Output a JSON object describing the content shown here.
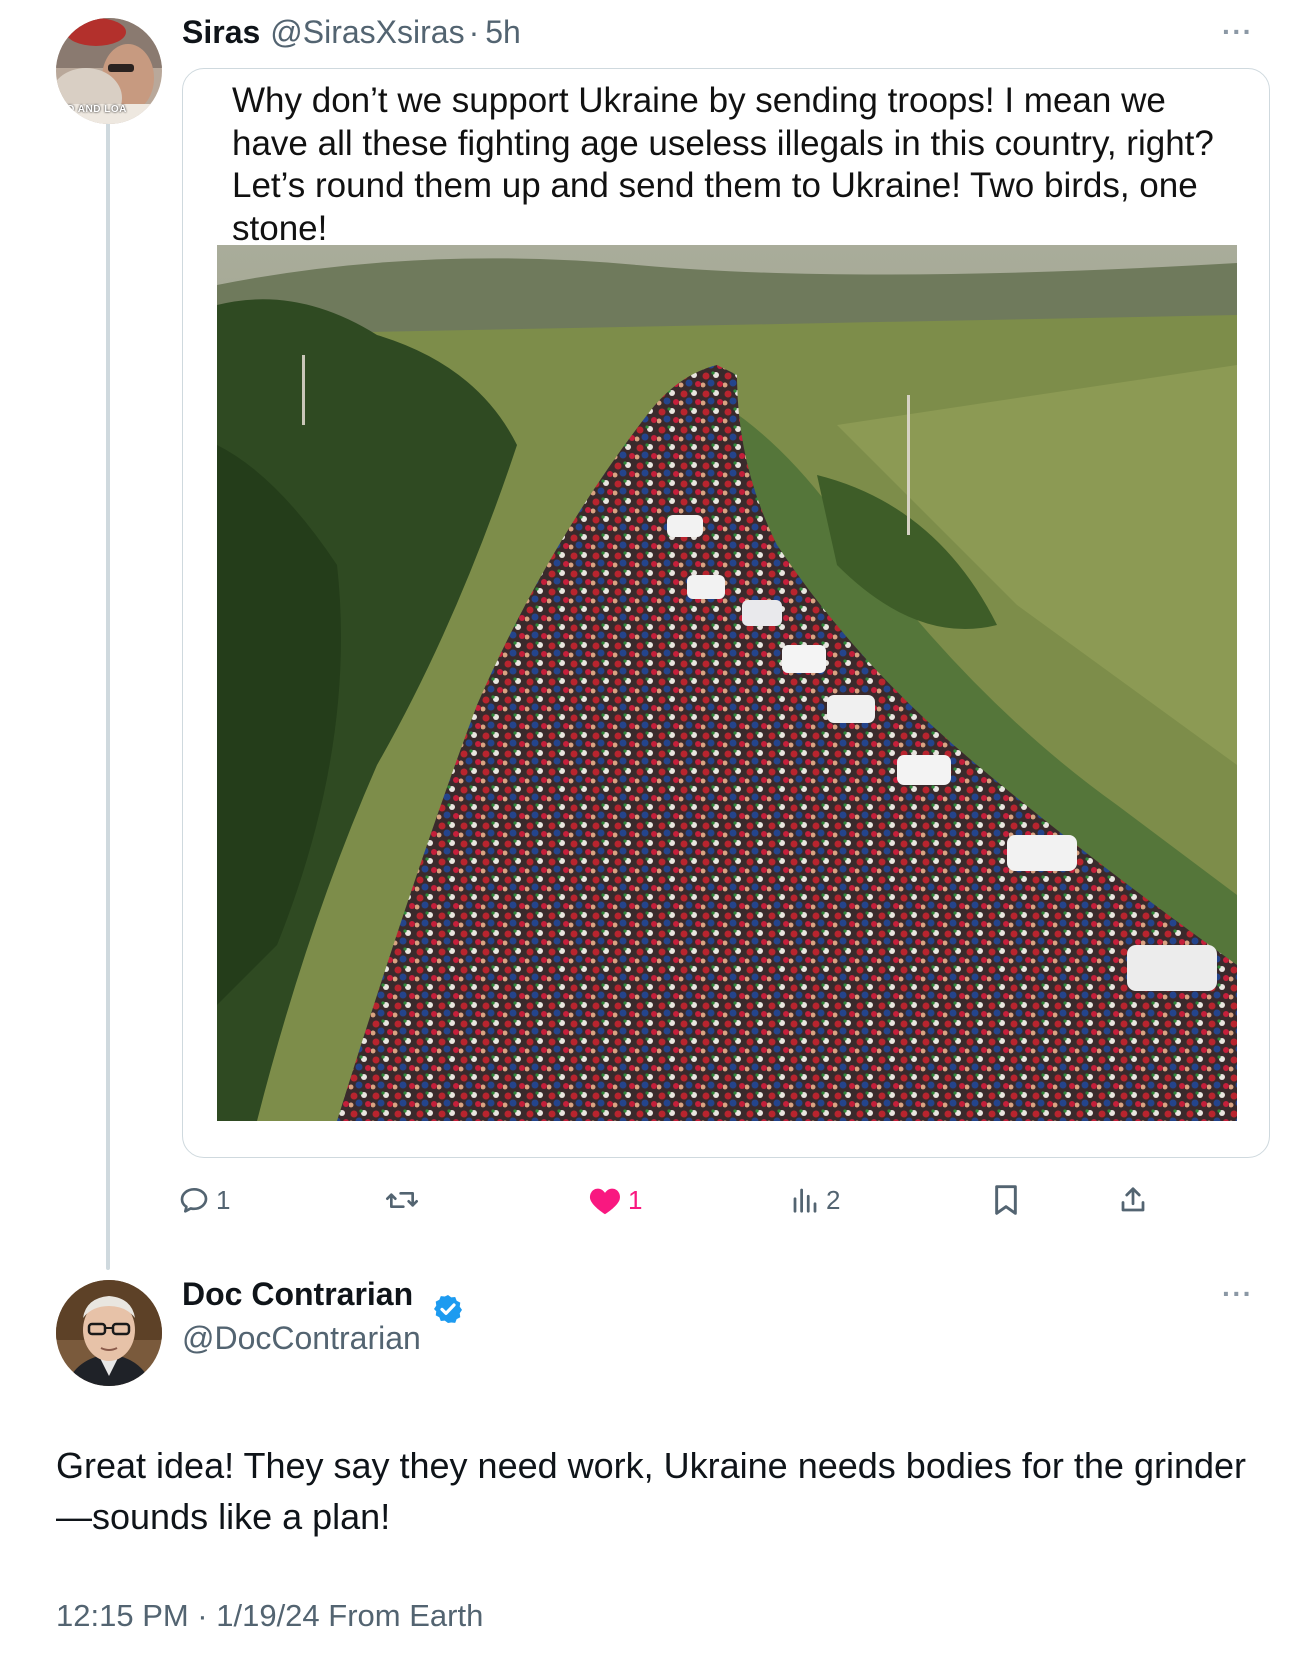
{
  "thread": {
    "quoted_post": {
      "author_name": "Siras",
      "author_handle": "@SirasXsiras",
      "separator": "·",
      "time_ago": "5h",
      "avatar_caption": "ED AND LOA",
      "more_icon": "more-horizontal-icon",
      "card": {
        "text": "Why don’t we support Ukraine by sending troops! I mean we have all these fighting age useless illegals in this country, right? Let’s round them up and send them to Ukraine! Two birds, one stone!",
        "photo_icon": "crowd-on-road-photo"
      },
      "actions": {
        "reply": {
          "icon": "reply-icon",
          "count": "1"
        },
        "repost": {
          "icon": "repost-icon",
          "count": ""
        },
        "like": {
          "icon": "heart-filled-icon",
          "count": "1",
          "color": "#f91880"
        },
        "views": {
          "icon": "views-icon",
          "count": "2"
        },
        "bookmark": {
          "icon": "bookmark-icon"
        },
        "share": {
          "icon": "share-icon"
        }
      }
    },
    "reply_post": {
      "author_name": "Doc Contrarian",
      "author_handle": "@DocContrarian",
      "verified_icon": "verified-badge-icon",
      "verified_color": "#1d9bf0",
      "more_icon": "more-horizontal-icon",
      "text": "Great idea! They say they need work, Ukraine needs bodies for the grinder—sounds like a plan!",
      "timestamp": "12:15 PM · 1/19/24 From Earth"
    }
  }
}
